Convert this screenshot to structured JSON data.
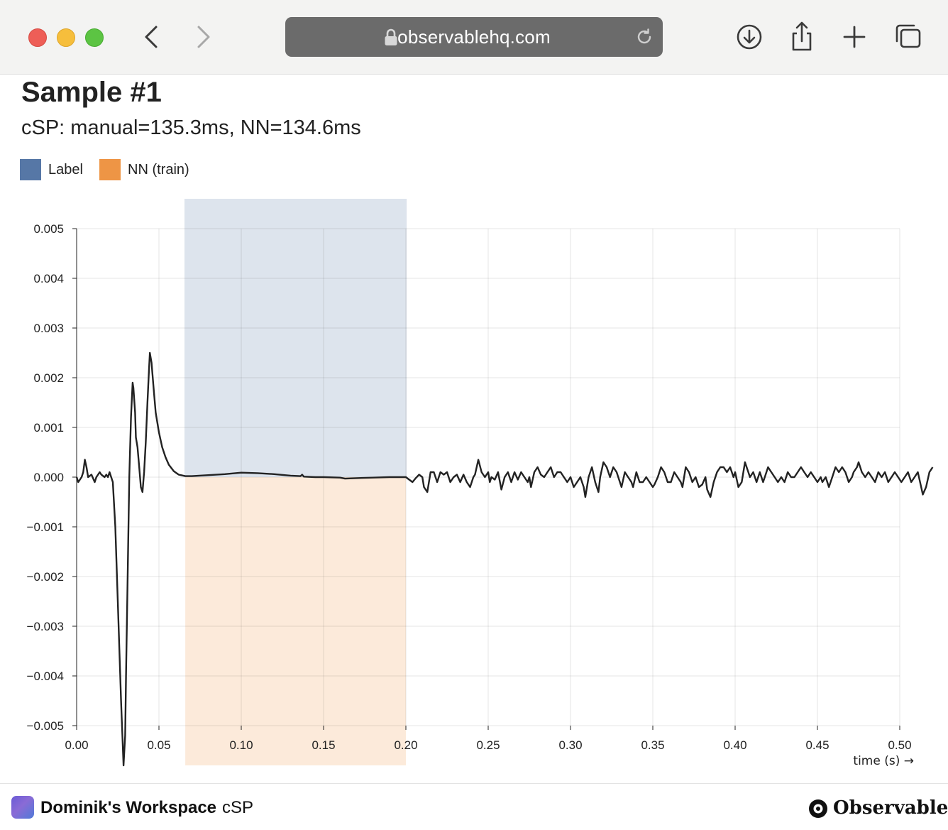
{
  "browser": {
    "url": "observablehq.com"
  },
  "page": {
    "title": "Sample #1",
    "subtitle": "cSP: manual=135.3ms, NN=134.6ms"
  },
  "legend": [
    {
      "label": "Label",
      "color": "#5677a6"
    },
    {
      "label": "NN (train)",
      "color": "#ee9545"
    }
  ],
  "chart_data": {
    "type": "line",
    "title": "",
    "xlabel": "time (s) →",
    "ylabel": "",
    "xlim": [
      0,
      0.52
    ],
    "ylim": [
      -0.005,
      0.005
    ],
    "grid": true,
    "x_ticks": [
      "0.00",
      "0.05",
      "0.10",
      "0.15",
      "0.20",
      "0.25",
      "0.30",
      "0.35",
      "0.40",
      "0.45",
      "0.50"
    ],
    "y_ticks": [
      "0.005",
      "0.004",
      "0.003",
      "0.002",
      "0.001",
      "0.000",
      "−0.001",
      "−0.002",
      "−0.003",
      "−0.004",
      "−0.005"
    ],
    "regions": [
      {
        "name": "Label",
        "x_start": 0.0655,
        "x_end": 0.2005,
        "y_from": 0.0,
        "y_to": 0.0056,
        "color": "#5677a6",
        "opacity": 0.2
      },
      {
        "name": "NN (train)",
        "x_start": 0.066,
        "x_end": 0.2,
        "y_from": 0.0,
        "y_to": -0.0058,
        "color": "#ee9545",
        "opacity": 0.2
      }
    ],
    "series": [
      {
        "color": "#222222",
        "points": [
          [
            0.0,
            0.0
          ],
          [
            0.001,
            -0.0001
          ],
          [
            0.003,
            0.0
          ],
          [
            0.004,
            0.0001
          ],
          [
            0.005,
            0.00035
          ],
          [
            0.006,
            0.0002
          ],
          [
            0.007,
            0.0
          ],
          [
            0.009,
            5e-05
          ],
          [
            0.011,
            -0.0001
          ],
          [
            0.012,
            0.0
          ],
          [
            0.014,
            0.0001
          ],
          [
            0.015,
            5e-05
          ],
          [
            0.017,
            0.0
          ],
          [
            0.018,
            5e-05
          ],
          [
            0.019,
            0.0
          ],
          [
            0.02,
            0.0001
          ],
          [
            0.021,
            0.0
          ],
          [
            0.022,
            -0.0001
          ],
          [
            0.0235,
            -0.001
          ],
          [
            0.025,
            -0.0025
          ],
          [
            0.027,
            -0.0045
          ],
          [
            0.0285,
            -0.0058
          ],
          [
            0.0295,
            -0.0052
          ],
          [
            0.03,
            -0.004
          ],
          [
            0.031,
            -0.002
          ],
          [
            0.032,
            0.0
          ],
          [
            0.033,
            0.0012
          ],
          [
            0.034,
            0.0019
          ],
          [
            0.0345,
            0.0018
          ],
          [
            0.0355,
            0.0013
          ],
          [
            0.036,
            0.0008
          ],
          [
            0.037,
            0.0006
          ],
          [
            0.038,
            0.0002
          ],
          [
            0.039,
            -0.0002
          ],
          [
            0.04,
            -0.0003
          ],
          [
            0.041,
            0.0001
          ],
          [
            0.042,
            0.0007
          ],
          [
            0.043,
            0.0015
          ],
          [
            0.044,
            0.0022
          ],
          [
            0.0445,
            0.0025
          ],
          [
            0.0455,
            0.0023
          ],
          [
            0.046,
            0.0021
          ],
          [
            0.047,
            0.0017
          ],
          [
            0.048,
            0.0013
          ],
          [
            0.05,
            0.0009
          ],
          [
            0.052,
            0.0006
          ],
          [
            0.054,
            0.0004
          ],
          [
            0.056,
            0.00025
          ],
          [
            0.059,
            0.00012
          ],
          [
            0.062,
            5e-05
          ],
          [
            0.066,
            2e-05
          ],
          [
            0.07,
            2e-05
          ],
          [
            0.08,
            4e-05
          ],
          [
            0.09,
            6e-05
          ],
          [
            0.1,
            9e-05
          ],
          [
            0.11,
            8e-05
          ],
          [
            0.12,
            6e-05
          ],
          [
            0.13,
            3e-05
          ],
          [
            0.136,
            2e-05
          ],
          [
            0.137,
            5e-05
          ],
          [
            0.138,
            1e-05
          ],
          [
            0.145,
            0.0
          ],
          [
            0.15,
            0.0
          ],
          [
            0.16,
            -1e-05
          ],
          [
            0.163,
            -3e-05
          ],
          [
            0.17,
            -2e-05
          ],
          [
            0.18,
            -1e-05
          ],
          [
            0.19,
            0.0
          ],
          [
            0.2,
            0.0
          ],
          [
            0.202,
            -5e-05
          ],
          [
            0.204,
            -0.0001
          ],
          [
            0.206,
            -2e-05
          ],
          [
            0.208,
            5e-05
          ],
          [
            0.21,
            0.0
          ],
          [
            0.211,
            -0.0002
          ],
          [
            0.213,
            -0.0003
          ],
          [
            0.215,
            0.0001
          ],
          [
            0.217,
            0.0001
          ],
          [
            0.219,
            -0.0001
          ],
          [
            0.221,
            0.0001
          ],
          [
            0.223,
            5e-05
          ],
          [
            0.225,
            0.0001
          ],
          [
            0.227,
            -0.0001
          ],
          [
            0.229,
            0.0
          ],
          [
            0.231,
            5e-05
          ],
          [
            0.233,
            -0.0001
          ],
          [
            0.235,
            5e-05
          ],
          [
            0.237,
            -0.0001
          ],
          [
            0.239,
            -0.0002
          ],
          [
            0.241,
            0.0
          ],
          [
            0.242,
            5e-05
          ],
          [
            0.244,
            0.00035
          ],
          [
            0.246,
            0.0001
          ],
          [
            0.248,
            0.0
          ],
          [
            0.25,
            0.0001
          ],
          [
            0.251,
            -0.0001
          ],
          [
            0.252,
            0.0
          ],
          [
            0.254,
            -5e-05
          ],
          [
            0.256,
            0.0001
          ],
          [
            0.258,
            -0.00025
          ],
          [
            0.26,
            0.0
          ],
          [
            0.262,
            0.0001
          ],
          [
            0.264,
            -0.0001
          ],
          [
            0.266,
            0.0001
          ],
          [
            0.268,
            -5e-05
          ],
          [
            0.27,
            0.0001
          ],
          [
            0.272,
            0.0
          ],
          [
            0.274,
            -0.0001
          ],
          [
            0.275,
            0.0
          ],
          [
            0.276,
            -0.0002
          ],
          [
            0.278,
            0.0001
          ],
          [
            0.28,
            0.0002
          ],
          [
            0.282,
            5e-05
          ],
          [
            0.284,
            0.0
          ],
          [
            0.286,
            0.0001
          ],
          [
            0.288,
            0.0002
          ],
          [
            0.29,
            0.0
          ],
          [
            0.292,
            0.0001
          ],
          [
            0.294,
            0.0001
          ],
          [
            0.296,
            0.0
          ],
          [
            0.298,
            -0.0001
          ],
          [
            0.3,
            0.0
          ],
          [
            0.302,
            -0.0002
          ],
          [
            0.304,
            -0.0001
          ],
          [
            0.306,
            0.0
          ],
          [
            0.308,
            -0.0002
          ],
          [
            0.309,
            -0.0004
          ],
          [
            0.311,
            0.0
          ],
          [
            0.313,
            0.0002
          ],
          [
            0.315,
            -0.0001
          ],
          [
            0.317,
            -0.0003
          ],
          [
            0.318,
            0.0
          ],
          [
            0.32,
            0.0003
          ],
          [
            0.322,
            0.0002
          ],
          [
            0.324,
            0.0
          ],
          [
            0.326,
            0.0002
          ],
          [
            0.328,
            0.0001
          ],
          [
            0.329,
            0.0
          ],
          [
            0.331,
            -0.0002
          ],
          [
            0.333,
            0.0001
          ],
          [
            0.335,
            0.0
          ],
          [
            0.337,
            -0.0001
          ],
          [
            0.338,
            -0.0002
          ],
          [
            0.34,
            0.0001
          ],
          [
            0.342,
            -0.0001
          ],
          [
            0.344,
            -0.0001
          ],
          [
            0.346,
            0.0
          ],
          [
            0.348,
            -0.0001
          ],
          [
            0.35,
            -0.0002
          ],
          [
            0.351,
            -0.00015
          ],
          [
            0.353,
            0.0
          ],
          [
            0.355,
            0.0002
          ],
          [
            0.357,
            0.0001
          ],
          [
            0.359,
            -0.0001
          ],
          [
            0.361,
            -0.0001
          ],
          [
            0.363,
            0.0001
          ],
          [
            0.365,
            0.0
          ],
          [
            0.367,
            -0.0001
          ],
          [
            0.368,
            -0.0002
          ],
          [
            0.37,
            0.0002
          ],
          [
            0.372,
            0.0001
          ],
          [
            0.374,
            -0.0001
          ],
          [
            0.376,
            0.0
          ],
          [
            0.378,
            -0.0002
          ],
          [
            0.38,
            -0.00015
          ],
          [
            0.382,
            0.0
          ],
          [
            0.383,
            -0.00025
          ],
          [
            0.385,
            -0.0004
          ],
          [
            0.387,
            -0.0001
          ],
          [
            0.389,
            0.0001
          ],
          [
            0.391,
            0.0002
          ],
          [
            0.393,
            0.0002
          ],
          [
            0.395,
            0.0001
          ],
          [
            0.397,
            0.0002
          ],
          [
            0.399,
            0.0
          ],
          [
            0.4,
            0.0001
          ],
          [
            0.402,
            -0.0002
          ],
          [
            0.404,
            -0.0001
          ],
          [
            0.406,
            0.0003
          ],
          [
            0.408,
            0.0001
          ],
          [
            0.409,
            0.0
          ],
          [
            0.411,
            0.0001
          ],
          [
            0.413,
            -0.0001
          ],
          [
            0.415,
            0.0001
          ],
          [
            0.417,
            -0.0001
          ],
          [
            0.418,
            0.0
          ],
          [
            0.42,
            0.0002
          ],
          [
            0.422,
            0.0001
          ],
          [
            0.424,
            0.0
          ],
          [
            0.426,
            -0.0001
          ],
          [
            0.428,
            0.0
          ],
          [
            0.43,
            -0.0001
          ],
          [
            0.432,
            0.0001
          ],
          [
            0.434,
            0.0
          ],
          [
            0.436,
            0.0
          ],
          [
            0.438,
            0.0001
          ],
          [
            0.44,
            0.0002
          ],
          [
            0.442,
            0.0001
          ],
          [
            0.444,
            0.0
          ],
          [
            0.446,
            0.0001
          ],
          [
            0.448,
            0.0
          ],
          [
            0.45,
            -0.0001
          ],
          [
            0.452,
            0.0
          ],
          [
            0.453,
            -0.0001
          ],
          [
            0.455,
            0.0
          ],
          [
            0.457,
            -0.0002
          ],
          [
            0.459,
            0.0
          ],
          [
            0.461,
            0.0002
          ],
          [
            0.463,
            0.0001
          ],
          [
            0.465,
            0.0002
          ],
          [
            0.467,
            0.0001
          ],
          [
            0.469,
            -0.0001
          ],
          [
            0.471,
            0.0
          ],
          [
            0.472,
            0.0001
          ],
          [
            0.474,
            0.0002
          ],
          [
            0.475,
            0.0003
          ],
          [
            0.477,
            0.0001
          ],
          [
            0.479,
            0.0
          ],
          [
            0.481,
            0.0001
          ],
          [
            0.483,
            0.0
          ],
          [
            0.485,
            -0.0001
          ],
          [
            0.487,
            0.0001
          ],
          [
            0.489,
            0.0
          ],
          [
            0.491,
            0.0001
          ],
          [
            0.493,
            -0.0001
          ],
          [
            0.495,
            0.0
          ],
          [
            0.497,
            0.0001
          ],
          [
            0.499,
            0.0
          ],
          [
            0.501,
            -0.0001
          ],
          [
            0.503,
            0.0
          ],
          [
            0.505,
            0.0001
          ],
          [
            0.507,
            -0.0001
          ],
          [
            0.509,
            0.0
          ],
          [
            0.511,
            0.0001
          ],
          [
            0.513,
            -0.0002
          ],
          [
            0.514,
            -0.00035
          ],
          [
            0.516,
            -0.0002
          ],
          [
            0.518,
            0.0001
          ],
          [
            0.52,
            0.0002
          ]
        ]
      }
    ]
  },
  "footer": {
    "workspace": "Dominik's Workspace",
    "notebook": "cSP",
    "brand": "Observable"
  }
}
